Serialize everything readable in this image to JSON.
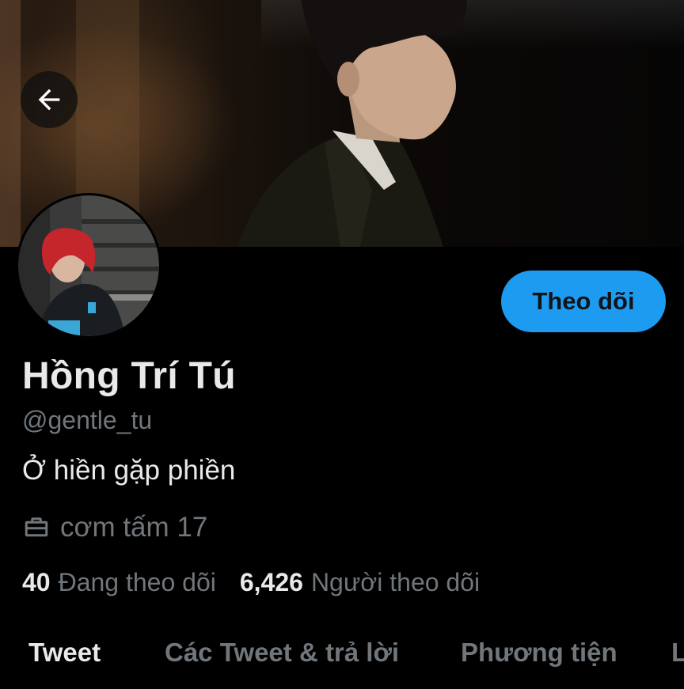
{
  "header": {
    "back_icon": "arrow-left-icon"
  },
  "profile": {
    "display_name": "Hồng Trí Tú",
    "handle": "@gentle_tu",
    "bio": "Ở hiền gặp phiền",
    "work": "cơm tấm 17",
    "work_icon": "briefcase-icon",
    "follow_label": "Theo dõi",
    "accent_color": "#1d9bf0"
  },
  "stats": {
    "following_count": "40",
    "following_label": "Đang theo dõi",
    "followers_count": "6,426",
    "followers_label": "Người theo dõi"
  },
  "tabs": [
    {
      "label": "Tweet",
      "active": true
    },
    {
      "label": "Các Tweet & trả lời",
      "active": false
    },
    {
      "label": "Phương tiện",
      "active": false
    },
    {
      "label": "L",
      "active": false
    }
  ]
}
